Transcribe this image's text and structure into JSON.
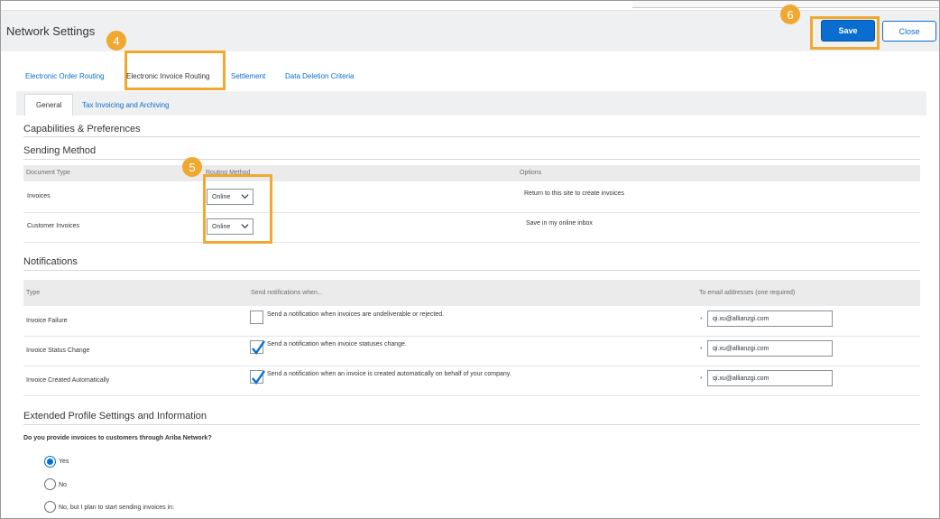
{
  "header": {
    "title": "Network Settings",
    "save_label": "Save",
    "close_label": "Close"
  },
  "callouts": {
    "c4": "4",
    "c5": "5",
    "c6": "6"
  },
  "tabs": [
    {
      "label": "Electronic Order Routing"
    },
    {
      "label": "Electronic Invoice Routing"
    },
    {
      "label": "Settlement"
    },
    {
      "label": "Data Deletion Criteria"
    }
  ],
  "subtabs": [
    {
      "label": "General"
    },
    {
      "label": "Tax Invoicing and Archiving"
    }
  ],
  "sections": {
    "capabilities": "Capabilities & Preferences",
    "sending_method": "Sending Method",
    "notifications": "Notifications",
    "extended": "Extended Profile Settings and Information"
  },
  "sending_table": {
    "headers": [
      "Document Type",
      "Routing Method",
      "Options"
    ],
    "rows": [
      {
        "doc_type": "Invoices",
        "method": "Online",
        "option": "Return to this site to create invoices"
      },
      {
        "doc_type": "Customer Invoices",
        "method": "Online",
        "option": "Save in my online inbox"
      }
    ]
  },
  "notif_table": {
    "headers": [
      "Type",
      "Send notifications when...",
      "To email addresses (one required)"
    ],
    "rows": [
      {
        "type": "Invoice Failure",
        "text": "Send a notification when invoices are undeliverable or rejected.",
        "checked": false,
        "req": "*",
        "email": "qi.xu@allianzgi.com"
      },
      {
        "type": "Invoice Status Change",
        "text": "Send a notification when invoice statuses change.",
        "checked": true,
        "req": "*",
        "email": "qi.xu@allianzgi.com"
      },
      {
        "type": "Invoice Created Automatically",
        "text": "Send a notification when an invoice is created automatically on behalf of your company.",
        "checked": true,
        "req": "*",
        "email": "qi.xu@allianzgi.com"
      }
    ]
  },
  "extended": {
    "question": "Do you provide invoices to customers through Ariba Network?",
    "options": [
      {
        "label": "Yes",
        "selected": true
      },
      {
        "label": "No",
        "selected": false
      },
      {
        "label": "No, but I plan to start sending invoices in:",
        "selected": false
      }
    ]
  },
  "colors": {
    "accent": "#0a6ed1",
    "highlight": "#f0a830"
  }
}
